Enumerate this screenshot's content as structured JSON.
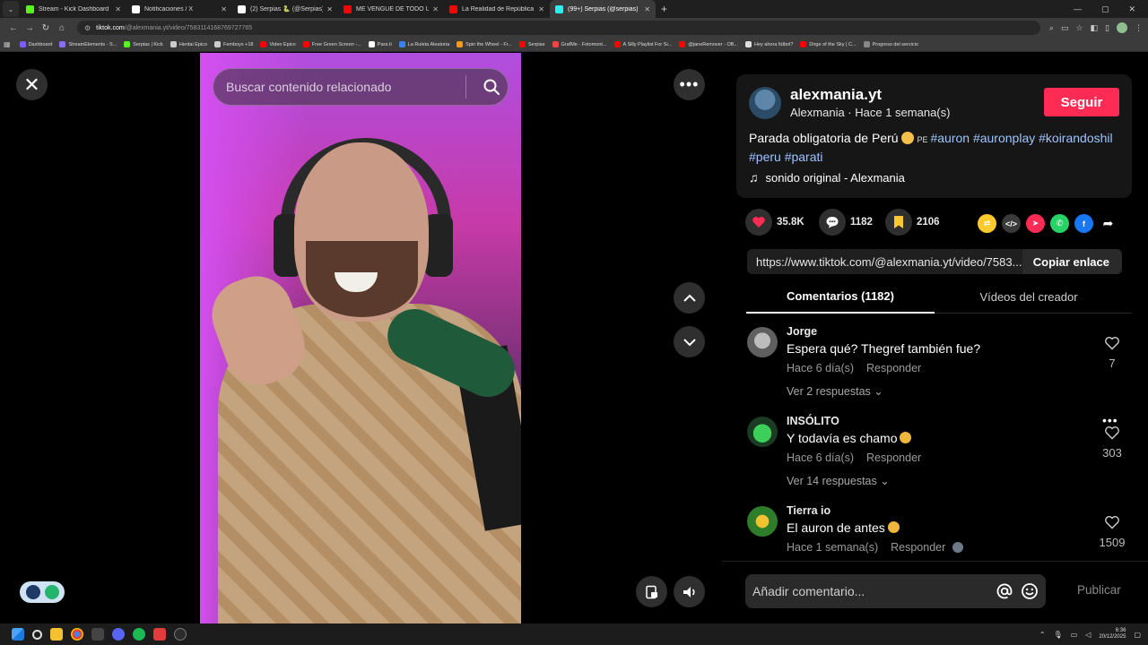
{
  "browser": {
    "tabs": [
      {
        "label": "Stream - Kick Dashboard",
        "favicon_color": "#53fc18",
        "active": false
      },
      {
        "label": "Notificaciones / X",
        "favicon_color": "#ffffff",
        "active": false
      },
      {
        "label": "(2) Serpias 🐍 (@Serpias) / X",
        "favicon_color": "#ffffff",
        "active": false
      },
      {
        "label": "ME VENGUÉ DE TODO UN SER",
        "favicon_color": "#ff0000",
        "active": false
      },
      {
        "label": "La Realidad de República Domi",
        "favicon_color": "#ff0000",
        "active": false
      },
      {
        "label": "(99+) Serpias (@serpias) | Ti",
        "favicon_color": "#25f4ee",
        "active": true
      }
    ],
    "url_host": "tiktok.com",
    "url_path": "/@alexmania.yt/video/7583114168769727765",
    "bookmarks": [
      {
        "label": "Dashboard",
        "color": "#7b5cff"
      },
      {
        "label": "StreamElements - S...",
        "color": "#8a6cff"
      },
      {
        "label": "Serpias | Kick",
        "color": "#53fc18"
      },
      {
        "label": "Hentai Epico",
        "color": "#cccccc"
      },
      {
        "label": "Femboys +18",
        "color": "#cccccc"
      },
      {
        "label": "Video Epico",
        "color": "#ff0000"
      },
      {
        "label": "Free Green Screen -...",
        "color": "#ff0000"
      },
      {
        "label": "Para ti",
        "color": "#ffffff"
      },
      {
        "label": "La Ruleta Aleatoria",
        "color": "#3b82f6"
      },
      {
        "label": "Spin the Wheel - Fr...",
        "color": "#f59e0b"
      },
      {
        "label": "Serpias",
        "color": "#ff0000"
      },
      {
        "label": "GrafMe - Fotomont...",
        "color": "#ef4444"
      },
      {
        "label": "A Silly Playlist For Si...",
        "color": "#ff0000"
      },
      {
        "label": "@janeRemover - OB...",
        "color": "#ff0000"
      },
      {
        "label": "Hey ahora fútbol?",
        "color": "#dddddd"
      },
      {
        "label": "Dirge of the Sky | C...",
        "color": "#ff0000"
      },
      {
        "label": "Progreso del servicio",
        "color": "#888888"
      }
    ]
  },
  "search": {
    "placeholder": "Buscar contenido relacionado"
  },
  "post": {
    "handle": "alexmania.yt",
    "subline": "Alexmania · Hace 1 semana(s)",
    "follow_label": "Seguir",
    "desc_text": "Parada obligatoria de Perú",
    "flag_label": "PE",
    "hashtags": [
      "#auron",
      "#auronplay",
      "#koirandoshil",
      "#peru",
      "#parati"
    ],
    "sound": "sonido original - Alexmania"
  },
  "actions": {
    "likes": "35.8K",
    "comments": "1182",
    "saves": "2106"
  },
  "share": {
    "link": "https://www.tiktok.com/@alexmania.yt/video/7583...",
    "copy_label": "Copiar enlace"
  },
  "panel_tabs": {
    "comments": "Comentarios (1182)",
    "creator_videos": "Vídeos del creador"
  },
  "comments": [
    {
      "user": "Jorge",
      "text": "Espera qué? Thegref también fue?",
      "time": "Hace 6 día(s)",
      "reply": "Responder",
      "replies": "Ver 2 respuestas",
      "likes": "7",
      "avatar_color": "#8a8a8a"
    },
    {
      "user": "INSÓLITO",
      "text": "Y todavía es chamo",
      "time": "Hace 6 día(s)",
      "reply": "Responder",
      "replies": "Ver 14 respuestas",
      "likes": "303",
      "avatar_color": "#2aa34a"
    },
    {
      "user": "Tierra io",
      "text": "El auron de antes",
      "time": "Hace 1 semana(s)",
      "reply": "Responder",
      "replies": "",
      "likes": "1509",
      "avatar_color": "#3a8f2e"
    }
  ],
  "composer": {
    "placeholder": "Añadir comentario...",
    "publish_label": "Publicar"
  },
  "taskbar": {
    "time": "6:36",
    "date": "20/12/2025"
  }
}
